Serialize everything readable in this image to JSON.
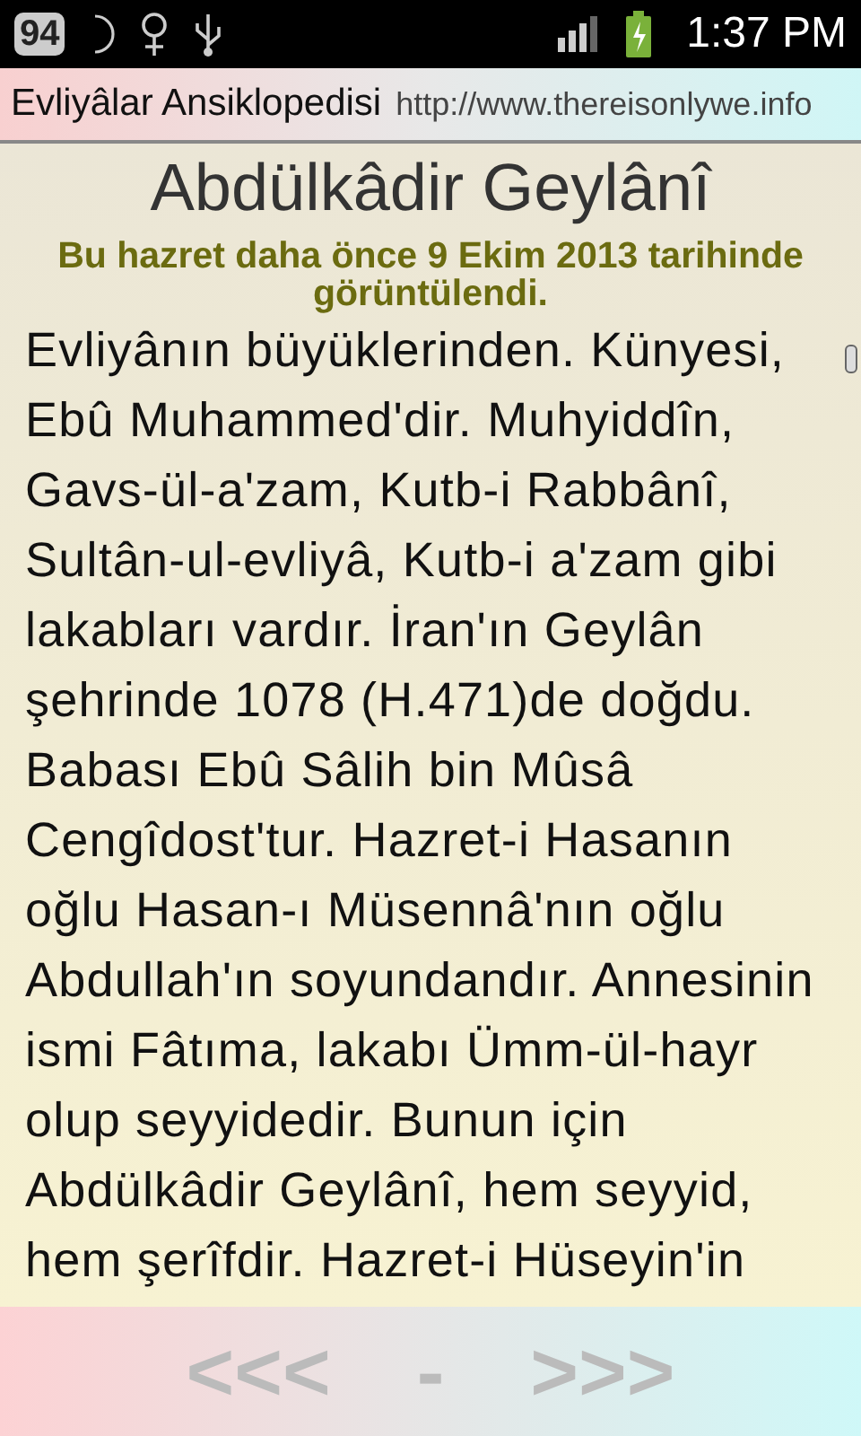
{
  "status_bar": {
    "notification_badge": "94",
    "time": "1:37 PM"
  },
  "title_bar": {
    "title": "Evliyâlar Ansiklopedisi",
    "url": "http://www.thereisonlywe.info"
  },
  "article": {
    "heading": "Abdülkâdir Geylânî",
    "notice": "Bu hazret daha önce 9 Ekim 2013 tarihinde görüntülendi.",
    "body": "Evliyânın büyüklerinden. Künyesi,\nEbû Muhammed'dir. Muhyiddîn,\nGavs-ül-a'zam, Kutb-i Rabbânî,\nSultân-ul-evliyâ, Kutb-i a'zam gibi\nlakabları vardır. İran'ın Geylân\nşehrinde 1078 (H.471)de doğdu.\nBabası Ebû Sâlih bin Mûsâ\nCengîdost'tur. Hazret-i Hasanın\noğlu Hasan-ı Müsennâ'nın oğlu\nAbdullah'ın soyundandır. Annesinin\nismi Fâtıma, lakabı Ümm-ül-hayr\nolup seyyidedir. Bunun için\nAbdülkâdir Geylânî, hem seyyid,\nhem şerîfdir. Hazret-i Hüseyin'in"
  },
  "navigation": {
    "previous": "<<<",
    "middle": "-",
    "next": ">>>"
  }
}
